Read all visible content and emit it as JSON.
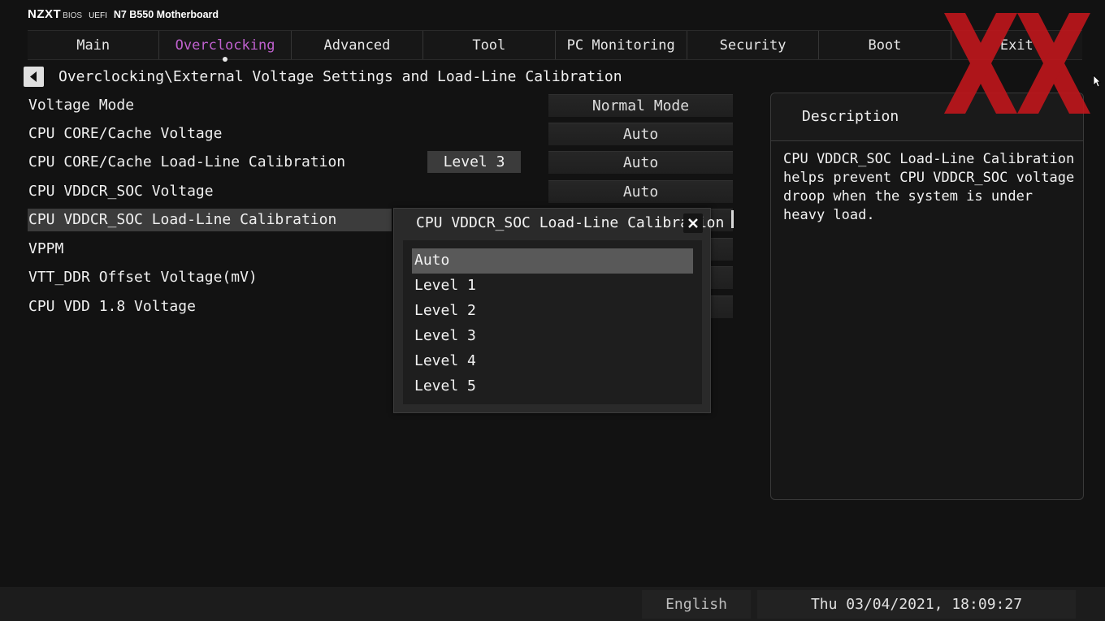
{
  "header": {
    "logo": "NZXT",
    "bios": "BIOS",
    "uefi": "UEFI",
    "model": "N7 B550 Motherboard"
  },
  "tabs": [
    {
      "label": "Main",
      "active": false
    },
    {
      "label": "Overclocking",
      "active": true
    },
    {
      "label": "Advanced",
      "active": false
    },
    {
      "label": "Tool",
      "active": false
    },
    {
      "label": "PC Monitoring",
      "active": false
    },
    {
      "label": "Security",
      "active": false
    },
    {
      "label": "Boot",
      "active": false
    },
    {
      "label": "Exit",
      "active": false
    }
  ],
  "breadcrumb": "Overclocking\\External Voltage Settings and Load-Line Calibration",
  "settings": [
    {
      "label": "Voltage Mode",
      "value": "Normal Mode"
    },
    {
      "label": "CPU CORE/Cache Voltage",
      "value": "Auto"
    },
    {
      "label": "CPU CORE/Cache Load-Line Calibration",
      "current": "Level 3",
      "value": "Auto"
    },
    {
      "label": "CPU VDDCR_SOC Voltage",
      "value": "Auto"
    },
    {
      "label": "CPU VDDCR_SOC Load-Line Calibration",
      "highlighted": true
    },
    {
      "label": "VPPM"
    },
    {
      "label": "VTT_DDR Offset Voltage(mV)"
    },
    {
      "label": "CPU VDD 1.8 Voltage"
    }
  ],
  "popup": {
    "title": "CPU VDDCR_SOC Load-Line Calibration",
    "options": [
      "Auto",
      "Level 1",
      "Level 2",
      "Level 3",
      "Level 4",
      "Level 5"
    ],
    "selected": "Auto"
  },
  "description": {
    "title": "Description",
    "text": "CPU VDDCR_SOC Load-Line Calibration helps prevent CPU VDDCR_SOC voltage droop when the system is under heavy load."
  },
  "footer": {
    "language": "English",
    "datetime": "Thu 03/04/2021, 18:09:27"
  },
  "colors": {
    "active_tab": "#c061cf",
    "watermark": "#c4161c"
  },
  "icons": {
    "back": "back-arrow-icon",
    "close": "close-icon",
    "watermark": "xx-watermark-logo"
  }
}
